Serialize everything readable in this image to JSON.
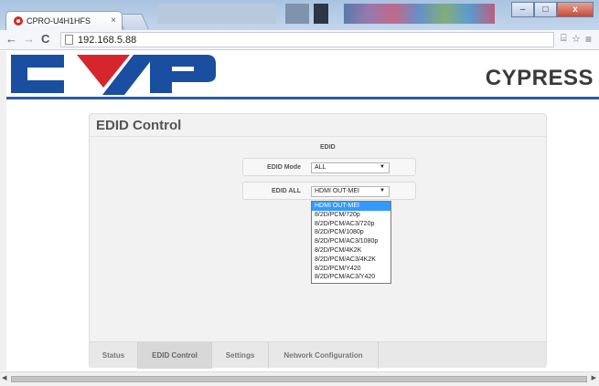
{
  "browser": {
    "tab_title": "CPRO-U4H1HFS",
    "tab_close": "×",
    "url": "192.168.5.88",
    "icons": [
      "back-arrow-icon",
      "forward-arrow-icon",
      "reload-icon",
      "page-icon",
      "translate-icon",
      "star-icon",
      "menu-icon"
    ],
    "window_buttons": {
      "minimize": "–",
      "maximize": "□",
      "close": "x"
    }
  },
  "header": {
    "brand": "CYPRESS",
    "colors": {
      "logo_blue": "#1a4ea0",
      "logo_red": "#d6262d",
      "rule": "#2b5aa8"
    }
  },
  "panel": {
    "title": "EDID Control",
    "section": "EDID",
    "rows": [
      {
        "label": "EDID Mode",
        "value": "ALL"
      },
      {
        "label": "EDID ALL",
        "value": "HDMI OUT-MEI"
      }
    ],
    "dropdown_options": [
      "HDMI OUT-MEI",
      "8/2D/PCM/720p",
      "8/2D/PCM/AC3/720p",
      "8/2D/PCM/1080p",
      "8/2D/PCM/AC3/1080p",
      "8/2D/PCM/4K2K",
      "8/2D/PCM/AC3/4K2K",
      "8/2D/PCM/Y420",
      "8/2D/PCM/AC3/Y420"
    ],
    "highlighted_option": "HDMI OUT-MEI",
    "tabs": [
      "Status",
      "EDID Control",
      "Settings",
      "Network Configuration"
    ],
    "active_tab": "EDID Control"
  }
}
